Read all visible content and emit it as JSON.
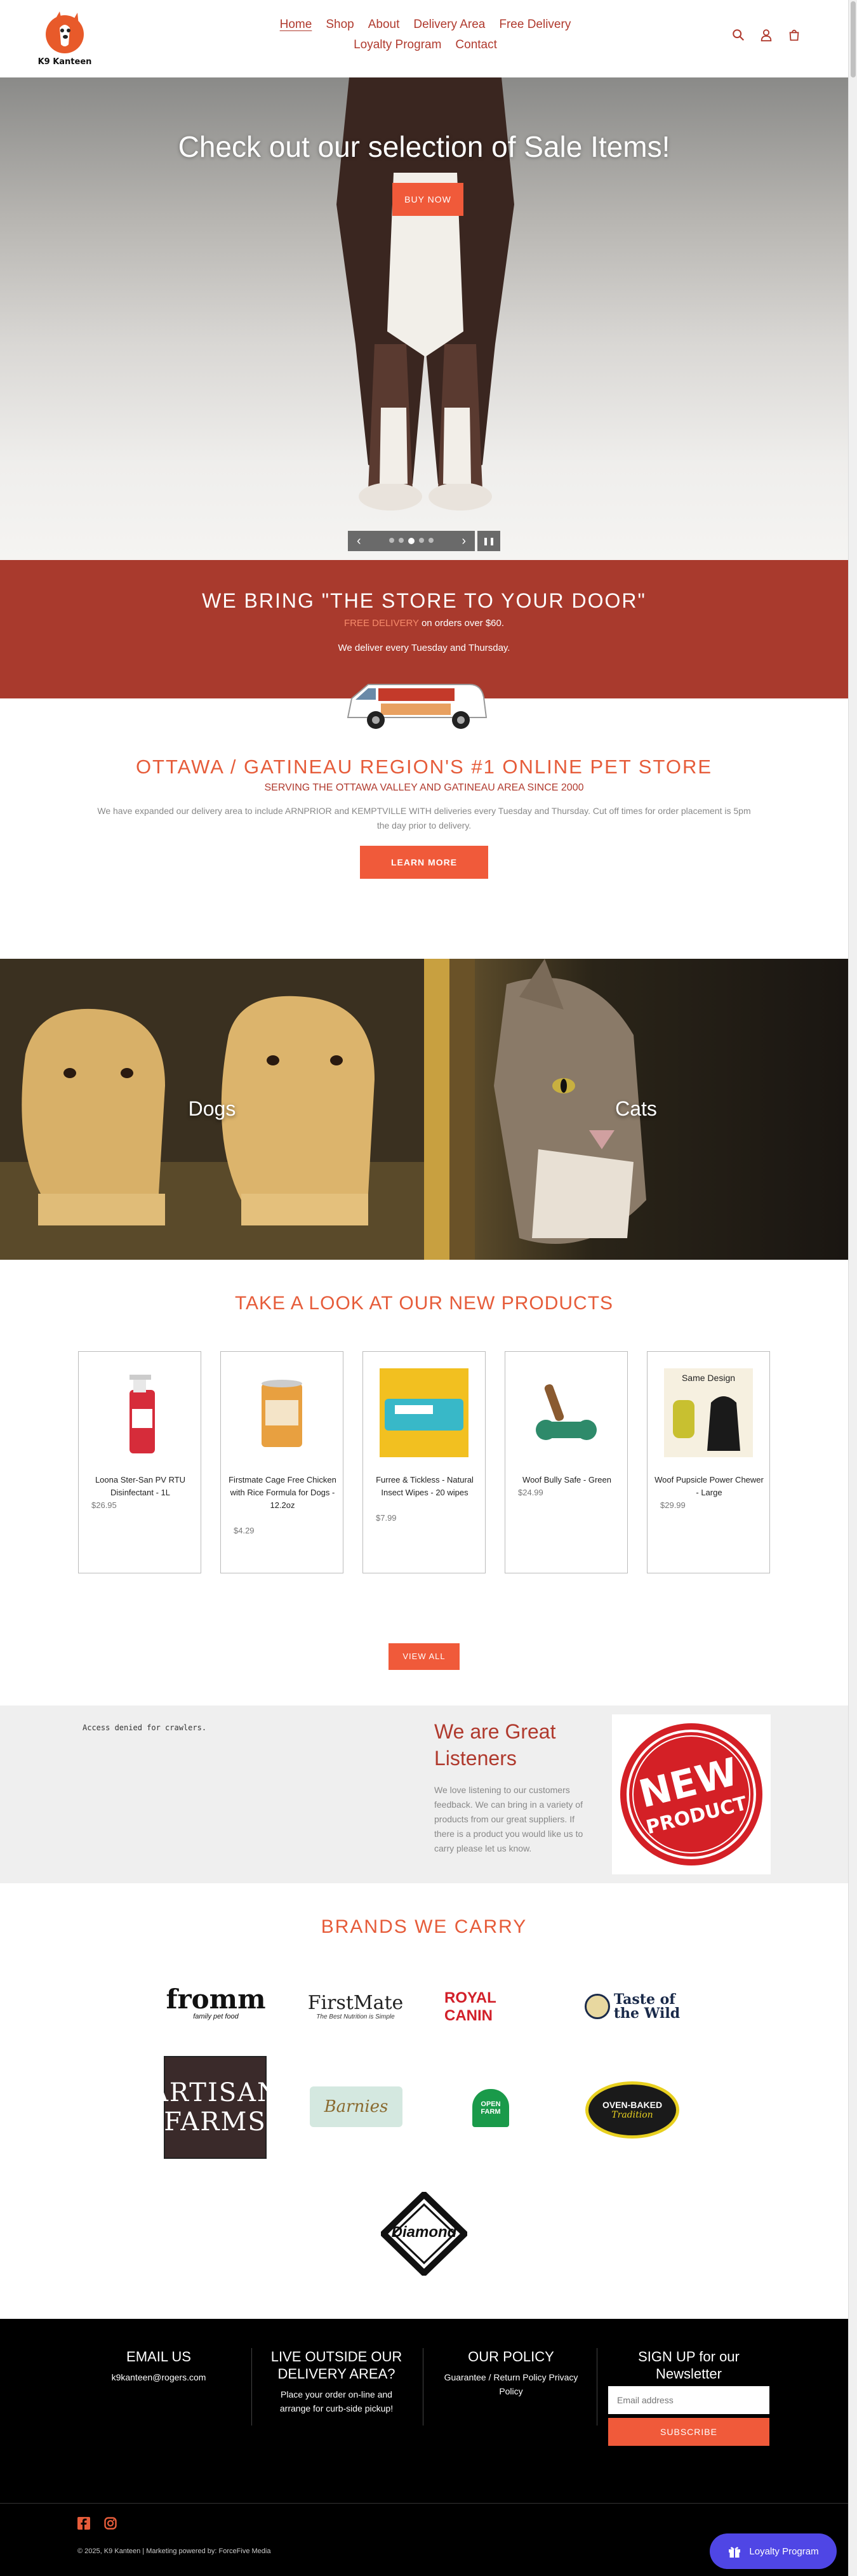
{
  "brand": {
    "name": "K9 Kanteen",
    "accent": "#b03a2e",
    "cta": "#f05a3a"
  },
  "nav": {
    "row1": [
      "Home",
      "Shop",
      "About",
      "Delivery Area",
      "Free Delivery"
    ],
    "row2": [
      "Loyalty Program",
      "Contact"
    ],
    "active": "Home"
  },
  "hero": {
    "title": "Check out our selection of Sale Items!",
    "button": "BUY NOW",
    "slides": 5,
    "current_slide": 3,
    "prev": "‹",
    "next": "›",
    "pause": "❚❚"
  },
  "delivery": {
    "title": "WE BRING \"THE STORE TO YOUR DOOR\"",
    "free_label": "FREE DELIVERY",
    "free_rest": " on orders over $60.",
    "days": "We deliver every Tuesday and Thursday."
  },
  "store": {
    "title": "OTTAWA / GATINEAU REGION'S #1 ONLINE PET STORE",
    "subtitle": "SERVING THE OTTAWA VALLEY AND GATINEAU AREA SINCE 2000",
    "body": "We have expanded our delivery area to include ARNPRIOR and KEMPTVILLE WITH deliveries every Tuesday and Thursday. Cut off times for order placement is 5pm the day prior to delivery.",
    "button": "LEARN MORE"
  },
  "pets": {
    "dogs": "Dogs",
    "cats": "Cats"
  },
  "new_products": {
    "title": "TAKE A LOOK AT OUR NEW PRODUCTS",
    "items": [
      {
        "name": "Loona Ster-San PV RTU Disinfectant - 1L",
        "price": "$26.95"
      },
      {
        "name": "Firstmate Cage Free Chicken with Rice Formula for Dogs - 12.2oz",
        "price": "$4.29"
      },
      {
        "name": "Furree & Tickless - Natural Insect Wipes - 20 wipes",
        "price": "$7.99"
      },
      {
        "name": "Woof Bully Safe - Green",
        "price": "$24.99"
      },
      {
        "name": "Woof Pupsicle Power Chewer - Large",
        "price": "$29.99"
      }
    ],
    "view_all": "VIEW ALL"
  },
  "listeners": {
    "denied": "Access denied for crawlers.",
    "title": "We are Great Listeners",
    "body": "We love listening to our customers feedback. We can bring in a variety of products from our great suppliers. If there is a product you would like us to carry please let us know.",
    "badge_line1": "NEW",
    "badge_line2": "PRODUCT"
  },
  "brands": {
    "title": "BRANDS WE CARRY",
    "fromm": "fromm",
    "fromm_sub": "family pet food",
    "firstmate": "FirstMate",
    "firstmate_sub": "The Best Nutrition is Simple",
    "royal": "ROYAL CANIN",
    "totw_1": "Taste of",
    "totw_2": "the Wild",
    "artisan_1": "ARTISAN",
    "artisan_2": "FARMS",
    "barnies": "Barnies",
    "openfarm_1": "OPEN",
    "openfarm_2": "FARM",
    "ovenbaked_1": "OVEN-BAKED",
    "ovenbaked_2": "Tradition",
    "diamond": "Diamond"
  },
  "footer": {
    "email_title": "EMAIL US",
    "email": "k9kanteen@rogers.com",
    "outside_title": "LIVE OUTSIDE OUR DELIVERY AREA?",
    "outside_text": "Place your order on-line and arrange for curb-side pickup!",
    "policy_title": "OUR POLICY",
    "policy_text": "Guarantee / Return Policy Privacy Policy",
    "signup_title": "SIGN UP for our Newsletter",
    "email_placeholder": "Email address",
    "subscribe": "SUBSCRIBE",
    "copyright": "© 2025, K9 Kanteen | Marketing powered by: ForceFive Media"
  },
  "loyalty_button": "Loyalty Program"
}
